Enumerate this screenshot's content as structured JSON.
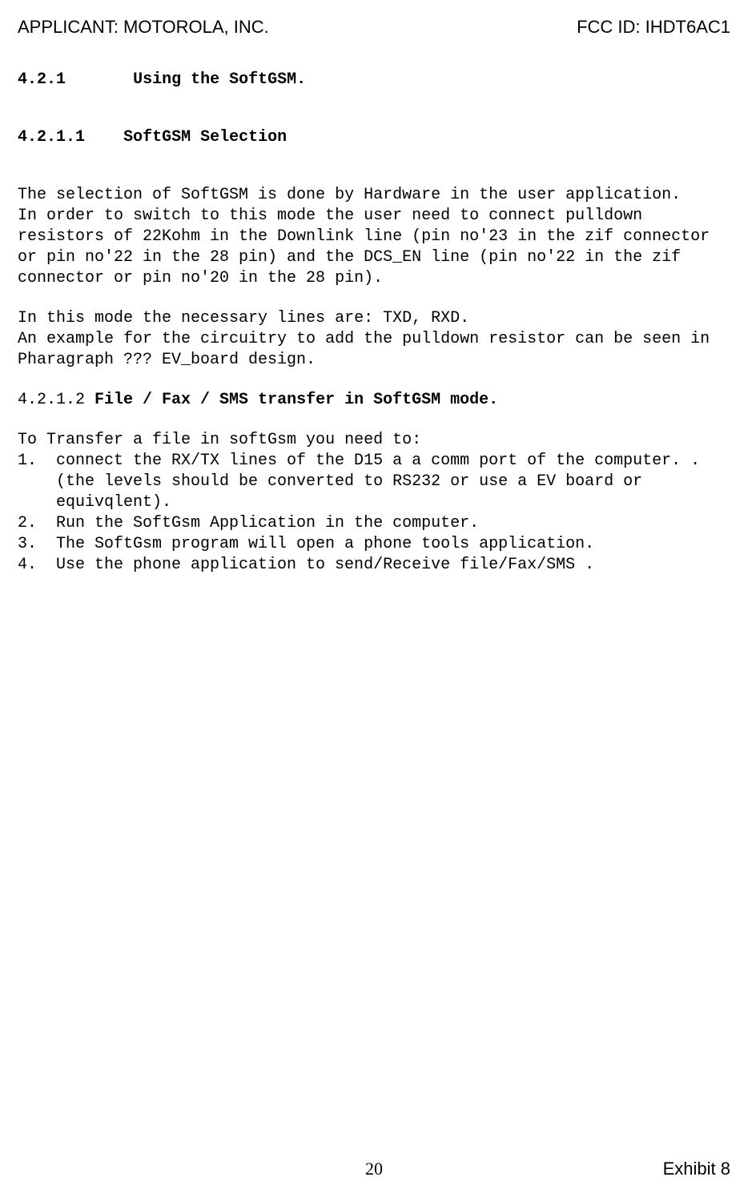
{
  "header": {
    "applicant_label": "APPLICANT:  MOTOROLA, INC.",
    "fcc_id": "FCC ID: IHDT6AC1"
  },
  "section1": {
    "num": "4.2.1",
    "title": "Using the SoftGSM."
  },
  "section2": {
    "num": "4.2.1.1",
    "title": "SoftGSM Selection"
  },
  "body": {
    "p1": "The selection of SoftGSM is done by Hardware in the user application.",
    "p2": "In order to switch to this mode the user need to connect pulldown resistors of 22Kohm in the Downlink line (pin no'23 in the zif connector or pin no'22 in the 28 pin) and the DCS_EN line (pin no'22 in the zif connector or pin no'20 in the 28 pin).",
    "p3": "In this mode the necessary lines are: TXD, RXD.",
    "p4": "An example for the circuitry to add the pulldown resistor can be seen in Pharagraph ??? EV_board design."
  },
  "section3": {
    "num": "4.2.1.2",
    "title": "File / Fax  / SMS transfer in SoftGSM mode."
  },
  "list_intro": "To Transfer a file in softGsm you need to:",
  "list": [
    {
      "n": "1.",
      "t": "connect the RX/TX lines of the D15 a a comm port of the computer. .(the levels should be converted to RS232 or use a EV board or equivqlent)."
    },
    {
      "n": "2.",
      "t": "Run the SoftGsm Application in the computer."
    },
    {
      "n": "3.",
      "t": "The SoftGsm program will open a phone tools application."
    },
    {
      "n": "4.",
      "t": "Use the phone application to send/Receive file/Fax/SMS ."
    }
  ],
  "footer": {
    "page": "20",
    "exhibit": "Exhibit 8"
  }
}
